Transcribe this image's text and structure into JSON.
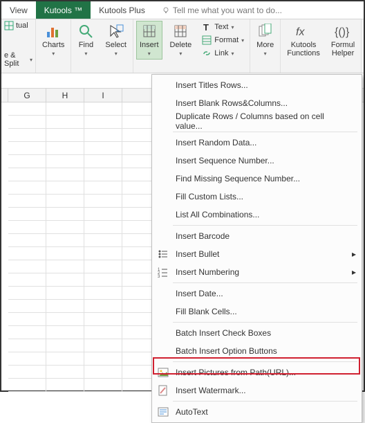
{
  "tabs": {
    "view": "View",
    "kutools": "Kutools ™",
    "kutools_plus": "Kutools Plus",
    "tell_me": "Tell me what you want to do..."
  },
  "ribbon": {
    "tual": "tual",
    "e_split": "e & Split",
    "charts": "Charts",
    "find": "Find",
    "select": "Select",
    "insert": "Insert",
    "delete": "Delete",
    "text": "Text",
    "format": "Format",
    "link": "Link",
    "more": "More",
    "kutools_functions": "Kutools\nFunctions",
    "formula_helper": "Formul\nHelper"
  },
  "columns": [
    "G",
    "H",
    "I"
  ],
  "menu": {
    "titles_rows": "Insert Titles Rows...",
    "blank_rows_cols": "Insert Blank Rows&Columns...",
    "duplicate_rows_cols": "Duplicate Rows / Columns based on cell value...",
    "random_data": "Insert Random Data...",
    "sequence_number": "Insert Sequence Number...",
    "find_missing_seq": "Find Missing Sequence Number...",
    "fill_custom_lists": "Fill Custom Lists...",
    "list_all_comb": "List All Combinations...",
    "barcode": "Insert Barcode",
    "bullet": "Insert Bullet",
    "numbering": "Insert Numbering",
    "date": "Insert Date...",
    "fill_blank_cells": "Fill Blank Cells...",
    "batch_check_boxes": "Batch Insert Check Boxes",
    "batch_option_buttons": "Batch Insert Option Buttons",
    "pictures_from_path": "Insert Pictures from Path(URL)...",
    "watermark": "Insert Watermark...",
    "autotext": "AutoText"
  }
}
